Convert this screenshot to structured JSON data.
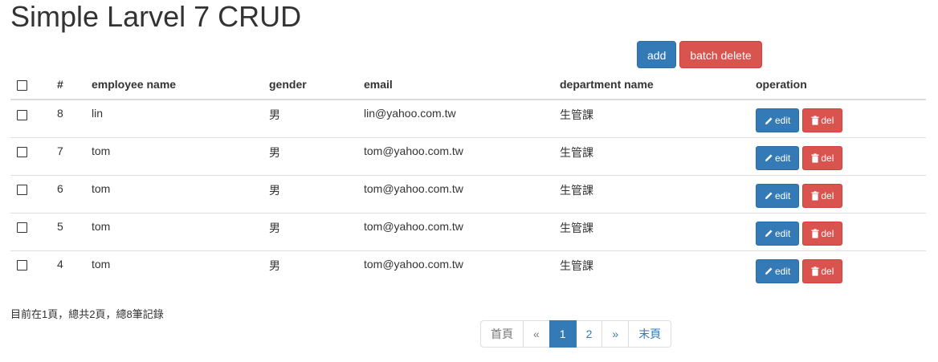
{
  "page": {
    "title": "Simple Larvel 7 CRUD"
  },
  "toolbar": {
    "add_label": "add",
    "batch_delete_label": "batch delete"
  },
  "table": {
    "headers": {
      "id": "#",
      "name": "employee name",
      "gender": "gender",
      "email": "email",
      "department": "department name",
      "operation": "operation"
    },
    "rows": [
      {
        "id": "8",
        "name": "lin",
        "gender": "男",
        "email": "lin@yahoo.com.tw",
        "department": "生管課"
      },
      {
        "id": "7",
        "name": "tom",
        "gender": "男",
        "email": "tom@yahoo.com.tw",
        "department": "生管課"
      },
      {
        "id": "6",
        "name": "tom",
        "gender": "男",
        "email": "tom@yahoo.com.tw",
        "department": "生管課"
      },
      {
        "id": "5",
        "name": "tom",
        "gender": "男",
        "email": "tom@yahoo.com.tw",
        "department": "生管課"
      },
      {
        "id": "4",
        "name": "tom",
        "gender": "男",
        "email": "tom@yahoo.com.tw",
        "department": "生管課"
      }
    ],
    "edit_label": "edit",
    "del_label": "del",
    "edit_icon": "pencil-icon",
    "del_icon": "trash-icon"
  },
  "summary": {
    "text": "目前在1頁，總共2頁，總8筆記錄"
  },
  "pagination": {
    "first": "首頁",
    "prev": "«",
    "pages": [
      "1",
      "2"
    ],
    "active_page": "1",
    "next": "»",
    "last": "末頁"
  },
  "colors": {
    "primary": "#337ab7",
    "danger": "#d9534f",
    "text": "#333333",
    "border": "#dddddd"
  }
}
